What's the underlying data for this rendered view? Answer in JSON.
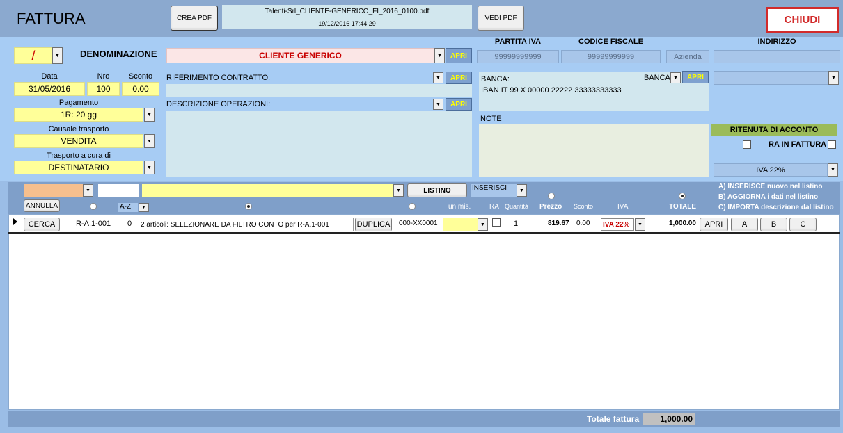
{
  "header": {
    "title": "FATTURA",
    "crea_pdf": "CREA PDF",
    "pdf_filename": "Talenti-Srl_CLIENTE-GENERICO_FI_2016_0100.pdf",
    "pdf_datetime": "19/12/2016 17:44:29",
    "vedi_pdf": "VEDI PDF",
    "chiudi": "CHIUDI"
  },
  "cliente": {
    "serie": "/",
    "denominazione_label": "DENOMINAZIONE",
    "denominazione": "CLIENTE GENERICO",
    "apri": "APRI",
    "partita_iva_label": "PARTITA IVA",
    "partita_iva": "99999999999",
    "codice_fiscale_label": "CODICE FISCALE",
    "codice_fiscale": "99999999999",
    "azienda": "Azienda",
    "indirizzo_label": "INDIRIZZO"
  },
  "doc": {
    "data_label": "Data",
    "data": "31/05/2016",
    "nro_label": "Nro",
    "nro": "100",
    "sconto_label": "Sconto",
    "sconto": "0.00",
    "pagamento_label": "Pagamento",
    "pagamento": "1R: 20 gg",
    "causale_label": "Causale trasporto",
    "causale": "VENDITA",
    "trasporto_label": "Trasporto a cura di",
    "trasporto": "DESTINATARIO"
  },
  "contratto": {
    "rif_label": "RIFERIMENTO CONTRATTO:",
    "desc_label": "DESCRIZIONE OPERAZIONI:",
    "apri": "APRI"
  },
  "banca": {
    "label": "BANCA:",
    "iban": "IBAN IT 99 X 00000 22222 33333333333",
    "select_label": "BANCA",
    "apri": "APRI"
  },
  "note_label": "NOTE",
  "ritenuta": {
    "label": "RITENUTA DI ACCONTO",
    "ra_in_fattura": "RA IN FATTURA",
    "iva": "IVA 22%"
  },
  "filter": {
    "listino": "LISTINO",
    "inserisci": "INSERISCI",
    "annulla": "ANNULLA",
    "az": "A-Z"
  },
  "legend": {
    "a": "A) INSERISCE nuovo nel listino",
    "b": "B) AGGIORNA i dati nel listino",
    "c": "C) IMPORTA descrizione dal listino"
  },
  "cols": {
    "unmis": "un.mis.",
    "ra": "RA",
    "quantita": "Quantità",
    "prezzo": "Prezzo",
    "sconto": "Sconto",
    "iva": "IVA",
    "totale": "TOTALE"
  },
  "row": {
    "cerca": "CERCA",
    "codice": "R-A.1-001",
    "n": "0",
    "descrizione": "2 articoli: SELEZIONARE DA FILTRO CONTO per R-A.1-001",
    "duplica": "DUPLICA",
    "conto": "000-XX0001",
    "quantita": "1",
    "prezzo": "819.67",
    "sconto": "0.00",
    "iva": "IVA 22%",
    "totale": "1,000.00",
    "apri": "APRI",
    "a": "A",
    "b": "B",
    "c": "C"
  },
  "footer": {
    "totale_label": "Totale fattura",
    "totale": "1,000.00"
  }
}
